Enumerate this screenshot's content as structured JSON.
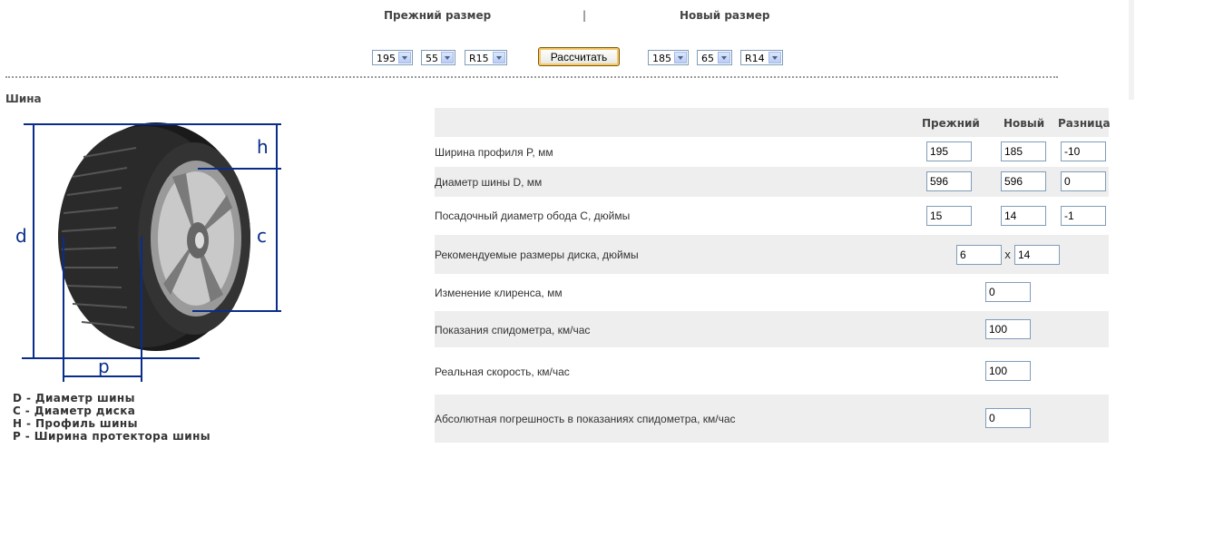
{
  "header": {
    "old_size_label": "Прежний размер",
    "separator": "|",
    "new_size_label": "Новый размер"
  },
  "controls": {
    "old_width": "195",
    "old_profile": "55",
    "old_rim": "R15",
    "calculate_label": "Рассчитать",
    "new_width": "185",
    "new_profile": "65",
    "new_rim": "R14"
  },
  "tire_section": {
    "title": "Шина",
    "labels": {
      "d": "d",
      "h": "h",
      "c": "c",
      "p": "p"
    },
    "legend": [
      "D - Диаметр шины",
      "C - Диаметр диска",
      "H - Профиль шины",
      "P - Ширина протектора шины"
    ]
  },
  "table": {
    "columns": {
      "old": "Прежний",
      "new": "Новый",
      "diff": "Разница"
    },
    "profile_width": {
      "label": "Ширина профиля P, мм",
      "old": "195",
      "new": "185",
      "diff": "-10"
    },
    "tire_diameter": {
      "label": "Диаметр шины D, мм",
      "old": "596",
      "new": "596",
      "diff": "0"
    },
    "rim_diameter": {
      "label": "Посадочный диаметр обода C, дюймы",
      "old": "15",
      "new": "14",
      "diff": "-1"
    },
    "recommended_rim": {
      "label": "Рекомендуемые размеры диска, дюймы",
      "width": "6",
      "sep": "x",
      "diameter": "14"
    },
    "clearance_change": {
      "label": "Изменение клиренса, мм",
      "value": "0"
    },
    "speedometer": {
      "label": "Показания спидометра, км/час",
      "value": "100"
    },
    "real_speed": {
      "label": "Реальная скорость, км/час",
      "value": "100"
    },
    "abs_error": {
      "label": "Абсолютная погрешность в показаниях спидометра, км/час",
      "value": "0"
    }
  }
}
